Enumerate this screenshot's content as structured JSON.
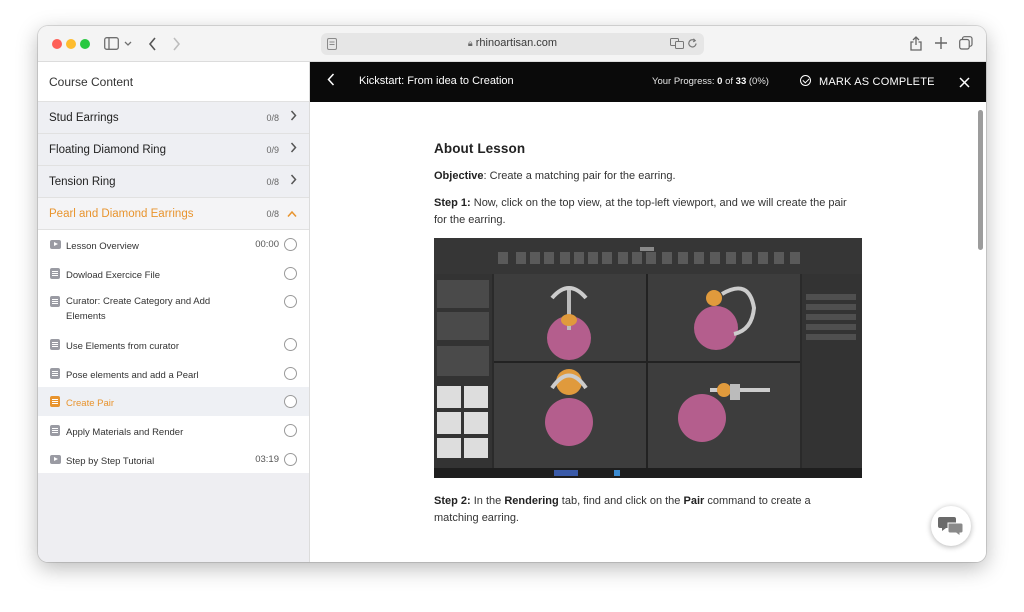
{
  "browser": {
    "url": "rhinoartisan.com",
    "colors": {
      "close": "#fe5f57",
      "minimize": "#febc2e",
      "zoom": "#28c840"
    }
  },
  "sidebar": {
    "header": "Course Content",
    "topics": [
      {
        "title": "Stud Earrings",
        "count": "0/8",
        "expanded": false
      },
      {
        "title": "Floating Diamond Ring",
        "count": "0/9",
        "expanded": false
      },
      {
        "title": "Tension Ring",
        "count": "0/8",
        "expanded": false
      },
      {
        "title": "Pearl and Diamond Earrings",
        "count": "0/8",
        "expanded": true
      }
    ],
    "lessons": [
      {
        "type": "video",
        "title": "Lesson Overview",
        "duration": "00:00"
      },
      {
        "type": "doc",
        "title": "Dowload Exercice File",
        "duration": ""
      },
      {
        "type": "doc",
        "title": "Curator: Create Category and Add Elements",
        "duration": ""
      },
      {
        "type": "doc",
        "title": "Use Elements from curator",
        "duration": ""
      },
      {
        "type": "doc",
        "title": "Pose elements and add a Pearl",
        "duration": ""
      },
      {
        "type": "doc",
        "title": "Create Pair",
        "duration": "",
        "current": true
      },
      {
        "type": "doc",
        "title": "Apply Materials and Render",
        "duration": ""
      },
      {
        "type": "video",
        "title": "Step by Step Tutorial",
        "duration": "03:19"
      }
    ]
  },
  "topbar": {
    "title": "Kickstart: From idea to Creation",
    "progress_label": "Your Progress:",
    "progress_done": "0",
    "progress_of": "of",
    "progress_total": "33",
    "progress_pct": "(0%)",
    "mark_complete": "MARK AS COMPLETE"
  },
  "lesson": {
    "heading": "About Lesson",
    "objective_label": "Objective",
    "objective_text": ": Create a matching pair for the earring.",
    "step1_label": "Step 1:",
    "step1_text": " Now, click on the top view, at the top-left viewport, and we will create the pair for the earring.",
    "step2_label": "Step 2:",
    "step2_text_a": " In the ",
    "step2_bold_a": "Rendering",
    "step2_text_b": " tab, find and click on the ",
    "step2_bold_b": "Pair",
    "step2_text_c": " command to create a matching earring."
  },
  "accent_color": "#e8942e"
}
